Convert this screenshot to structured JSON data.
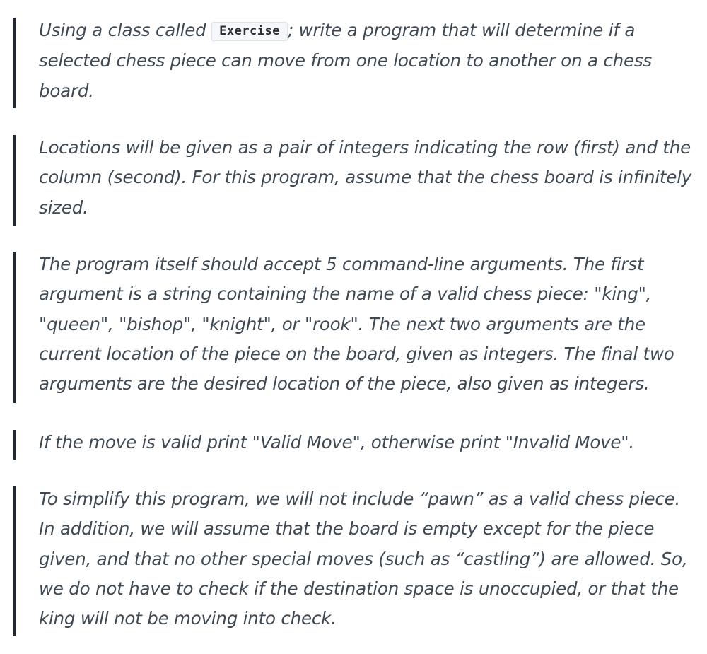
{
  "blocks": [
    {
      "before_code": "Using a class called ",
      "code": "Exercise",
      "after_code": "; write a program that will determine if a selected chess piece can move from one location to another on a chess board."
    },
    {
      "text": "Locations will be given as a pair of integers indicating the row (first) and the column (second). For this program, assume that the chess board is infinitely sized."
    },
    {
      "text": "The program itself should accept 5 command-line arguments. The first argument is a string containing the name of a valid chess piece: \"king\", \"queen\", \"bishop\", \"knight\", or \"rook\". The next two arguments are the current location of the piece on the board, given as integers. The final two arguments are the desired location of the piece, also given as integers."
    },
    {
      "text": "If the move is valid print \"Valid Move\", otherwise print \"Invalid Move\"."
    },
    {
      "text": "To simplify this program, we will not include “pawn” as a valid chess piece. In addition, we will assume that the board is empty except for the piece given, and that no other special moves (such as “castling”) are allowed. So, we do not have to check if the destination space is unoccupied, or that the king will not be moving into check."
    }
  ],
  "colors": {
    "quote_border": "#1f2a36",
    "text": "#3f4954",
    "code_background": "#f5f7fa",
    "code_border": "#dde3ea"
  }
}
